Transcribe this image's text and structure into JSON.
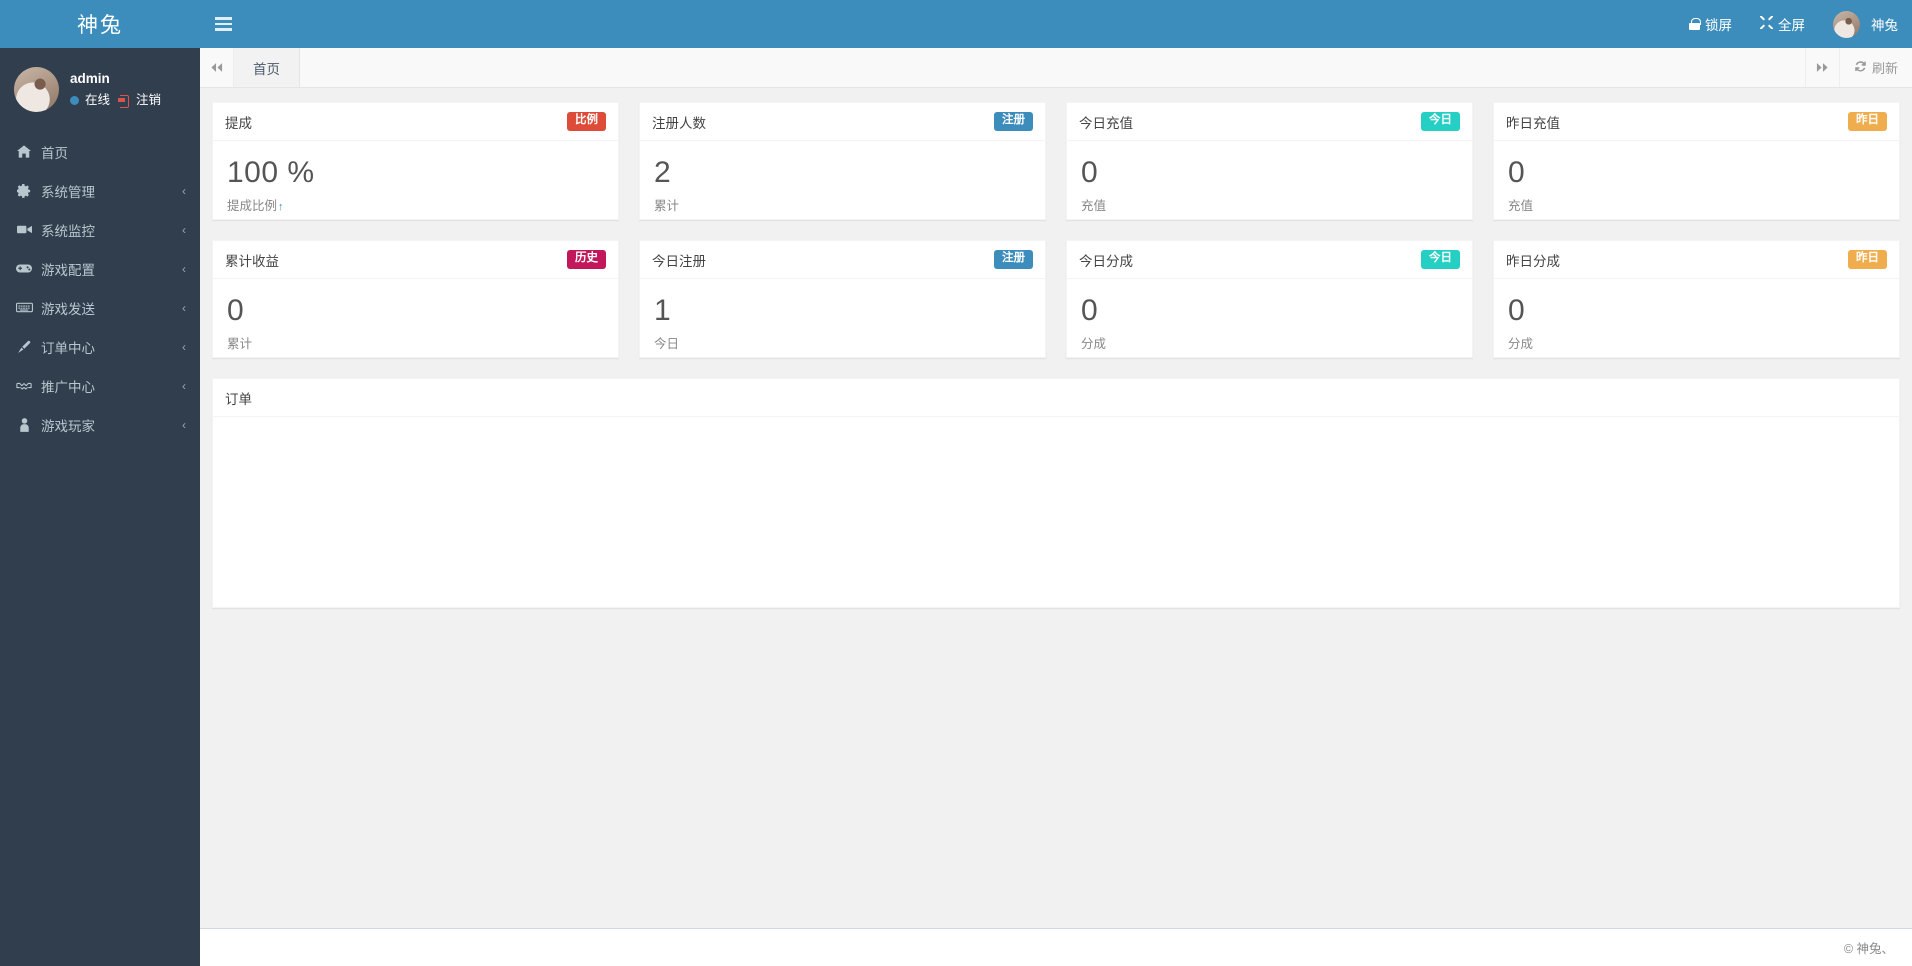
{
  "brand": {
    "logo_text": "神兔"
  },
  "user_panel": {
    "username": "admin",
    "status_label": "在线",
    "logout_label": "注销"
  },
  "sidebar": {
    "items": [
      {
        "label": "首页",
        "icon": "home-icon",
        "has_arrow": false
      },
      {
        "label": "系统管理",
        "icon": "gear-icon",
        "has_arrow": true,
        "arrow": "‹"
      },
      {
        "label": "系统监控",
        "icon": "video-icon",
        "has_arrow": true,
        "arrow": "‹"
      },
      {
        "label": "游戏配置",
        "icon": "gamepad-icon",
        "has_arrow": true,
        "arrow": "‹"
      },
      {
        "label": "游戏发送",
        "icon": "keyboard-icon",
        "has_arrow": true,
        "arrow": "‹"
      },
      {
        "label": "订单中心",
        "icon": "brush-icon",
        "has_arrow": true,
        "arrow": "‹"
      },
      {
        "label": "推广中心",
        "icon": "handshake-icon",
        "has_arrow": true,
        "arrow": "‹"
      },
      {
        "label": "游戏玩家",
        "icon": "user-icon",
        "has_arrow": true,
        "arrow": "‹"
      }
    ]
  },
  "navbar": {
    "lock_label": "锁屏",
    "fullscreen_label": "全屏",
    "fullscreen_icon": "⤢",
    "account_label": "神兔"
  },
  "tabbar": {
    "prev_icon": "◀◀",
    "next_icon": "▶▶",
    "tabs": [
      {
        "label": "首页",
        "active": true
      }
    ],
    "refresh_label": "刷新",
    "refresh_icon": "↻"
  },
  "cards": [
    {
      "title": "提成",
      "badge": "比例",
      "badge_color": "red",
      "value": "100 %",
      "sub": "提成比例",
      "sub_arrow": "↑"
    },
    {
      "title": "注册人数",
      "badge": "注册",
      "badge_color": "blue",
      "value": "2",
      "sub": "累计",
      "sub_arrow": ""
    },
    {
      "title": "今日充值",
      "badge": "今日",
      "badge_color": "teal",
      "value": "0",
      "sub": "充值",
      "sub_arrow": ""
    },
    {
      "title": "昨日充值",
      "badge": "昨日",
      "badge_color": "orange",
      "value": "0",
      "sub": "充值",
      "sub_arrow": ""
    },
    {
      "title": "累计收益",
      "badge": "历史",
      "badge_color": "maroon",
      "value": "0",
      "sub": "累计",
      "sub_arrow": ""
    },
    {
      "title": "今日注册",
      "badge": "注册",
      "badge_color": "blue",
      "value": "1",
      "sub": "今日",
      "sub_arrow": ""
    },
    {
      "title": "今日分成",
      "badge": "今日",
      "badge_color": "teal",
      "value": "0",
      "sub": "分成",
      "sub_arrow": ""
    },
    {
      "title": "昨日分成",
      "badge": "昨日",
      "badge_color": "orange",
      "value": "0",
      "sub": "分成",
      "sub_arrow": ""
    }
  ],
  "order_panel": {
    "title": "订单"
  },
  "footer": {
    "copyright": "© 神兔、"
  },
  "colors": {
    "brand_blue": "#3c8dbc",
    "sidebar_dark": "#303e4d",
    "badge_red": "#dd4b39",
    "badge_blue": "#3c8dbc",
    "badge_teal": "#25cfc4",
    "badge_orange": "#f0ad4e",
    "badge_maroon": "#c2185b"
  }
}
